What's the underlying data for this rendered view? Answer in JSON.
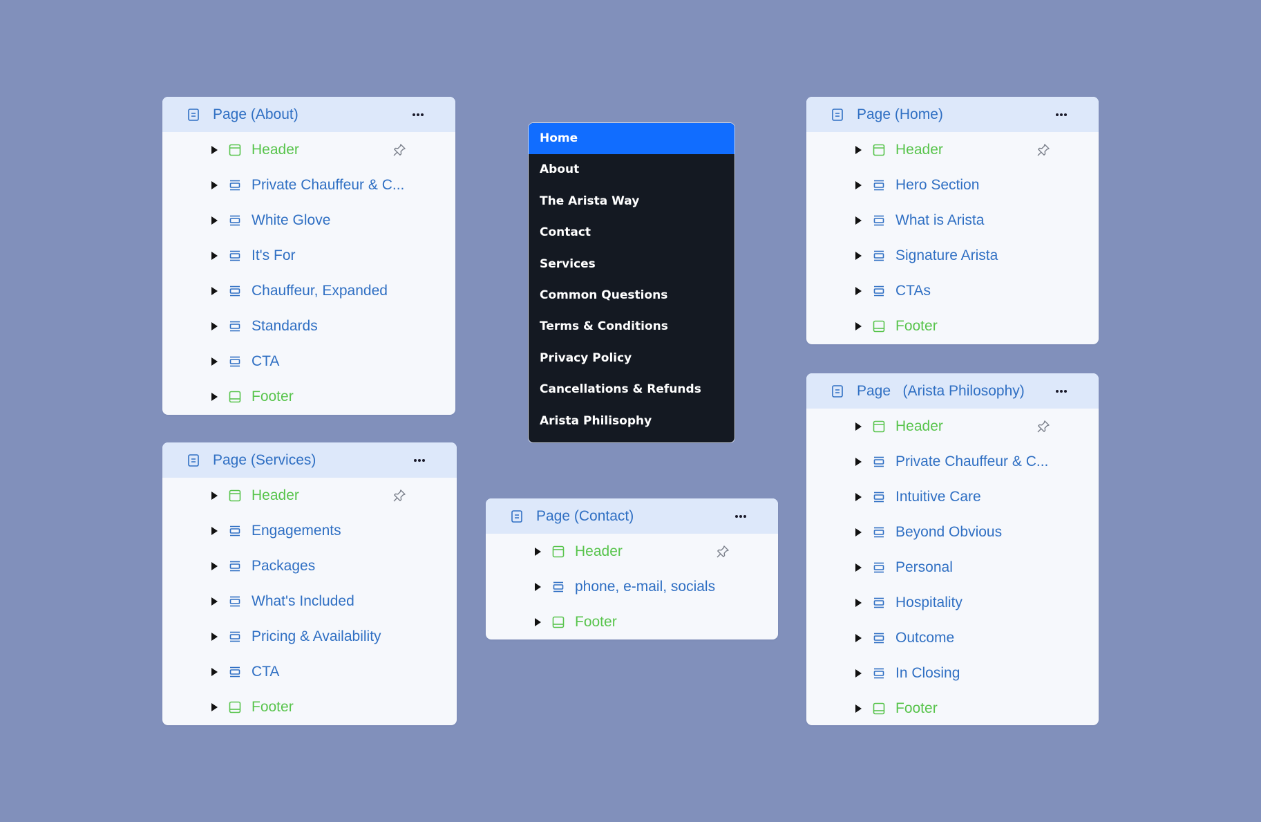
{
  "colors": {
    "background": "#8190bb",
    "panel": "#f6f8fc",
    "panel_header": "#dde8fa",
    "blue_text": "#2f6fc3",
    "green_text": "#58c44c",
    "menu_bg": "#141922",
    "menu_active": "#116dff"
  },
  "panels": {
    "about": {
      "title": "Page (About)",
      "items": [
        {
          "label": "Header",
          "kind": "header"
        },
        {
          "label": "Private Chauffeur & C...",
          "kind": "section"
        },
        {
          "label": "White Glove",
          "kind": "section"
        },
        {
          "label": "It's For",
          "kind": "section"
        },
        {
          "label": "Chauffeur, Expanded",
          "kind": "section"
        },
        {
          "label": "Standards",
          "kind": "section"
        },
        {
          "label": "CTA",
          "kind": "section"
        },
        {
          "label": "Footer",
          "kind": "footer"
        }
      ]
    },
    "services": {
      "title": "Page (Services)",
      "items": [
        {
          "label": "Header",
          "kind": "header"
        },
        {
          "label": "Engagements",
          "kind": "section"
        },
        {
          "label": "Packages",
          "kind": "section"
        },
        {
          "label": "What's Included",
          "kind": "section"
        },
        {
          "label": "Pricing & Availability",
          "kind": "section"
        },
        {
          "label": "CTA",
          "kind": "section"
        },
        {
          "label": "Footer",
          "kind": "footer"
        }
      ]
    },
    "contact": {
      "title": "Page (Contact)",
      "items": [
        {
          "label": "Header",
          "kind": "header"
        },
        {
          "label": "phone, e-mail, socials",
          "kind": "section"
        },
        {
          "label": "Footer",
          "kind": "footer"
        }
      ]
    },
    "home": {
      "title": "Page (Home)",
      "items": [
        {
          "label": "Header",
          "kind": "header"
        },
        {
          "label": "Hero Section",
          "kind": "section"
        },
        {
          "label": "What is Arista",
          "kind": "section"
        },
        {
          "label": "Signature Arista",
          "kind": "section"
        },
        {
          "label": "CTAs",
          "kind": "section"
        },
        {
          "label": "Footer",
          "kind": "footer"
        }
      ]
    },
    "philosophy": {
      "title": "Page   (Arista Philosophy)",
      "items": [
        {
          "label": "Header",
          "kind": "header"
        },
        {
          "label": "Private Chauffeur & C...",
          "kind": "section"
        },
        {
          "label": "Intuitive Care",
          "kind": "section"
        },
        {
          "label": "Beyond Obvious",
          "kind": "section"
        },
        {
          "label": "Personal",
          "kind": "section"
        },
        {
          "label": "Hospitality",
          "kind": "section"
        },
        {
          "label": "Outcome",
          "kind": "section"
        },
        {
          "label": "In Closing",
          "kind": "section"
        },
        {
          "label": "Footer",
          "kind": "footer"
        }
      ]
    }
  },
  "menu": {
    "items": [
      {
        "label": "Home",
        "active": true
      },
      {
        "label": "About"
      },
      {
        "label": "The Arista Way"
      },
      {
        "label": "Contact"
      },
      {
        "label": "Services"
      },
      {
        "label": "Common Questions"
      },
      {
        "label": "Terms & Conditions"
      },
      {
        "label": "Privacy Policy"
      },
      {
        "label": "Cancellations & Refunds"
      },
      {
        "label": "Arista Philisophy"
      }
    ]
  },
  "icons": {
    "page": "page-icon",
    "more": "more-options-icon",
    "header": "header-section-icon",
    "section": "section-icon",
    "footer": "footer-section-icon",
    "pin": "pin-icon",
    "expand": "expand-caret-icon"
  }
}
